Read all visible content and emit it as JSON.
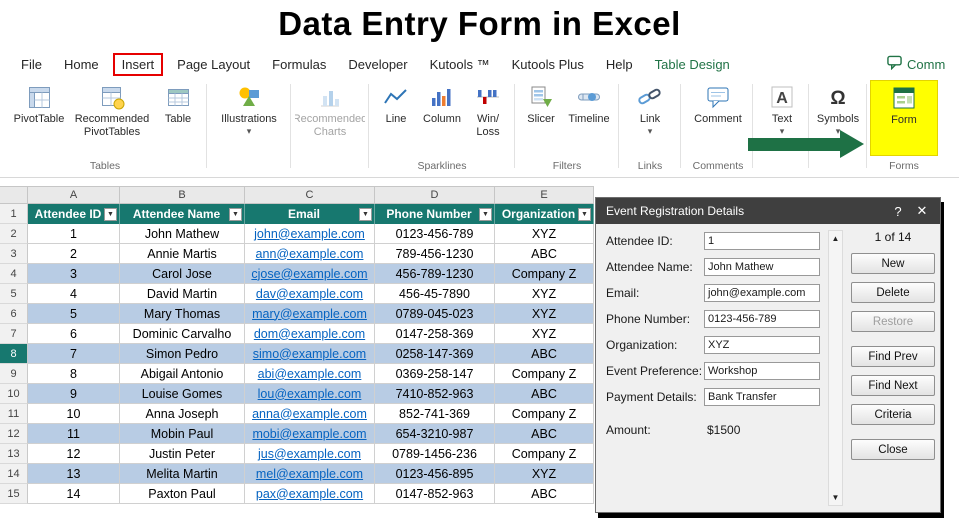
{
  "title": "Data Entry Form in Excel",
  "icons": {
    "caret": "▾",
    "filter": "▼",
    "scroll_up": "▲",
    "scroll_down": "▼",
    "help": "?",
    "close": "✕"
  },
  "colors": {
    "table-header": "#17786F",
    "band-blue": "#b8cce4",
    "link-blue": "#0563C1",
    "excel-green": "#217346",
    "arrow-green": "#1e7145",
    "highlight-yellow": "#ffff00",
    "annotation-red": "#e60000",
    "titlebar-gray": "#3f3f3f"
  },
  "ribbon": {
    "tabs": [
      {
        "label": "File"
      },
      {
        "label": "Home"
      },
      {
        "label": "Insert",
        "highlighted": true
      },
      {
        "label": "Page Layout"
      },
      {
        "label": "Formulas"
      },
      {
        "label": "Developer"
      },
      {
        "label": "Kutools ™"
      },
      {
        "label": "Kutools Plus"
      },
      {
        "label": "Help"
      },
      {
        "label": "Table Design",
        "green": true
      }
    ],
    "comments_button": "Comm",
    "buttons": {
      "pivottable": "PivotTable",
      "recommended_pivottables": "Recommended PivotTables",
      "table": "Table",
      "illustrations": "Illustrations",
      "recommended_charts": "Recommended Charts",
      "line": "Line",
      "column": "Column",
      "win_loss": "Win/ Loss",
      "slicer": "Slicer",
      "timeline": "Timeline",
      "link": "Link",
      "comment": "Comment",
      "text": "Text",
      "symbols": "Symbols",
      "form": "Form"
    },
    "group_labels": {
      "tables": "Tables",
      "sparklines": "Sparklines",
      "filters": "Filters",
      "links": "Links",
      "comments": "Comments",
      "forms": "Forms"
    }
  },
  "sheet": {
    "column_letters": [
      "A",
      "B",
      "C",
      "D",
      "E"
    ],
    "header_row_number": "1",
    "headers": [
      "Attendee ID",
      "Attendee Name",
      "Email",
      "Phone Number",
      "Organization"
    ],
    "rows": [
      {
        "n": "2",
        "id": "1",
        "name": "John Mathew",
        "email": "john@example.com",
        "phone": "0123-456-789",
        "org": "XYZ"
      },
      {
        "n": "3",
        "id": "2",
        "name": "Annie Martis",
        "email": "ann@example.com",
        "phone": "789-456-1230",
        "org": "ABC"
      },
      {
        "n": "4",
        "id": "3",
        "name": "Carol Jose",
        "email": "cjose@example.com",
        "phone": "456-789-1230",
        "org": "Company Z"
      },
      {
        "n": "5",
        "id": "4",
        "name": "David Martin",
        "email": "dav@example.com",
        "phone": "456-45-7890",
        "org": "XYZ"
      },
      {
        "n": "6",
        "id": "5",
        "name": "Mary Thomas",
        "email": "mary@example.com",
        "phone": "0789-045-023",
        "org": "XYZ"
      },
      {
        "n": "7",
        "id": "6",
        "name": "Dominic Carvalho",
        "email": "dom@example.com",
        "phone": "0147-258-369",
        "org": "XYZ"
      },
      {
        "n": "8",
        "id": "7",
        "name": "Simon Pedro",
        "email": "simo@example.com",
        "phone": "0258-147-369",
        "org": "ABC"
      },
      {
        "n": "9",
        "id": "8",
        "name": "Abigail Antonio",
        "email": "abi@example.com",
        "phone": "0369-258-147",
        "org": "Company Z"
      },
      {
        "n": "10",
        "id": "9",
        "name": "Louise Gomes",
        "email": "lou@example.com",
        "phone": "7410-852-963",
        "org": "ABC"
      },
      {
        "n": "11",
        "id": "10",
        "name": "Anna Joseph",
        "email": "anna@example.com",
        "phone": "852-741-369",
        "org": "Company Z"
      },
      {
        "n": "12",
        "id": "11",
        "name": "Mobin Paul",
        "email": "mobi@example.com",
        "phone": "654-3210-987",
        "org": "ABC"
      },
      {
        "n": "13",
        "id": "12",
        "name": "Justin Peter",
        "email": "jus@example.com",
        "phone": "0789-1456-236",
        "org": "Company Z"
      },
      {
        "n": "14",
        "id": "13",
        "name": "Melita Martin",
        "email": "mel@example.com",
        "phone": "0123-456-895",
        "org": "XYZ"
      },
      {
        "n": "15",
        "id": "14",
        "name": "Paxton Paul",
        "email": "pax@example.com",
        "phone": "0147-852-963",
        "org": "ABC"
      }
    ]
  },
  "dialog": {
    "title": "Event Registration Details",
    "record_indicator": "1 of 14",
    "fields": [
      {
        "label": "Attendee ID:",
        "value": "1"
      },
      {
        "label": "Attendee Name:",
        "value": "John Mathew"
      },
      {
        "label": "Email:",
        "value": "john@example.com"
      },
      {
        "label": "Phone Number:",
        "value": "0123-456-789"
      },
      {
        "label": "Organization:",
        "value": "XYZ"
      },
      {
        "label": "Event Preference:",
        "value": "Workshop"
      },
      {
        "label": "Payment Details:",
        "value": "Bank Transfer"
      },
      {
        "label": "Amount:",
        "value": "$1500",
        "plain": true
      }
    ],
    "buttons": [
      {
        "label": "New"
      },
      {
        "label": "Delete"
      },
      {
        "label": "Restore",
        "disabled": true
      },
      {
        "label": "Find Prev",
        "gap": true
      },
      {
        "label": "Find Next"
      },
      {
        "label": "Criteria"
      },
      {
        "label": "Close",
        "gap": true
      }
    ]
  }
}
